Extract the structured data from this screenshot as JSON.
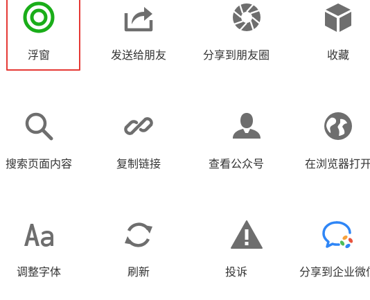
{
  "menu": {
    "items": [
      {
        "label": "浮窗",
        "icon": "floating-window-icon",
        "selected": true
      },
      {
        "label": "发送给朋友",
        "icon": "share-to-friend-icon"
      },
      {
        "label": "分享到朋友圈",
        "icon": "moments-icon"
      },
      {
        "label": "收藏",
        "icon": "favorite-cube-icon"
      },
      {
        "label": "搜索页面内容",
        "icon": "search-icon"
      },
      {
        "label": "复制链接",
        "icon": "link-icon"
      },
      {
        "label": "查看公众号",
        "icon": "official-account-icon"
      },
      {
        "label": "在浏览器打开",
        "icon": "globe-icon"
      },
      {
        "label": "调整字体",
        "icon": "font-size-icon"
      },
      {
        "label": "刷新",
        "icon": "refresh-icon"
      },
      {
        "label": "投诉",
        "icon": "warning-icon"
      },
      {
        "label": "分享到企业微信",
        "icon": "wecom-icon"
      }
    ]
  },
  "colors": {
    "icon_gray": "#6e6e6e",
    "floating_green": "#1aad19",
    "selection_red": "#e53935",
    "label_text": "#333333",
    "wecom_blue": "#2f86f6",
    "wecom_orange": "#f8a23b",
    "wecom_red": "#e8543f",
    "wecom_green": "#4ebd5a"
  }
}
